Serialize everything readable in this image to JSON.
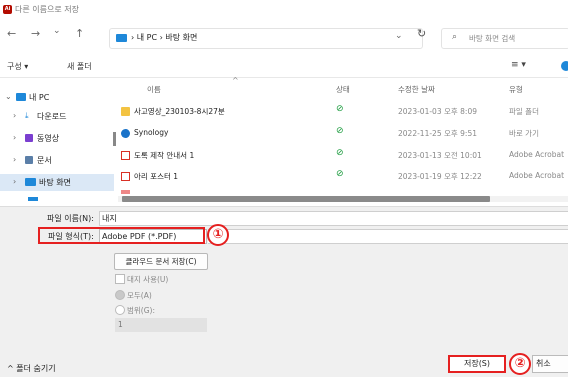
{
  "window": {
    "title": "다른 이름으로 저장",
    "app_icon_text": "Ai"
  },
  "nav": {
    "back": "←",
    "forward": "→",
    "recent": "⌄",
    "up": "↑",
    "address_path": "› 내 PC › 바탕 화면",
    "address_chevron": "⌄",
    "refresh": "↻",
    "search_placeholder": "바탕 화면 검색"
  },
  "toolbar": {
    "organize": "구성 ▾",
    "new_folder": "새 폴더",
    "view": "≡ ▾"
  },
  "sidebar": {
    "items": [
      {
        "label": "내 PC",
        "chevron": "⌄",
        "icon": "pc-icon",
        "color": "#1e88d9"
      },
      {
        "label": "다운로드",
        "chevron": "›",
        "icon": "download-icon",
        "color": "#1e88d9"
      },
      {
        "label": "동영상",
        "chevron": "›",
        "icon": "video-icon",
        "color": "#7b3fd0"
      },
      {
        "label": "문서",
        "chevron": "›",
        "icon": "document-icon",
        "color": "#5b7fa8"
      },
      {
        "label": "바탕 화면",
        "chevron": "›",
        "icon": "desktop-icon",
        "color": "#1e88d9"
      }
    ]
  },
  "file_list": {
    "columns": [
      "이름",
      "상태",
      "수정한 날짜",
      "유형"
    ],
    "sort_indicator": "^",
    "rows": [
      {
        "name": "사고영상_230103-8시27분",
        "icon": "folder-icon",
        "status": "⊘",
        "date": "2023-01-03 오후 8:09",
        "type": "파일 폴더"
      },
      {
        "name": "Synology",
        "icon": "synology-shortcut-icon",
        "status": "⊘",
        "date": "2022-11-25 오후 9:51",
        "type": "바로 가기"
      },
      {
        "name": "도록 제작 안내서 1",
        "icon": "pdf-icon",
        "status": "⊘",
        "date": "2023-01-13 오전 10:01",
        "type": "Adobe Acrobat"
      },
      {
        "name": "아리 포스터 1",
        "icon": "pdf-icon",
        "status": "⊘",
        "date": "2023-01-19 오후 12:22",
        "type": "Adobe Acrobat"
      }
    ]
  },
  "form": {
    "filename_label": "파일 이름(N):",
    "filename_value": "내지",
    "filetype_label": "파일 형식(T):",
    "filetype_value": "Adobe PDF (*.PDF)",
    "cloud_save": "클라우드 문서 저장(C)",
    "spread_label": "대지 사용(U)",
    "all_label": "모두(A)",
    "range_label": "범위(G):",
    "range_value": "1"
  },
  "annotations": {
    "step1": "①",
    "step2": "②"
  },
  "footer": {
    "hide_folders": "^ 폴더 숨기기",
    "save": "저장(S)",
    "cancel": "취소"
  },
  "colors": {
    "highlight": "#e52020",
    "accent": "#1e88d9",
    "pdf": "#d93025",
    "folder": "#f3c342"
  }
}
